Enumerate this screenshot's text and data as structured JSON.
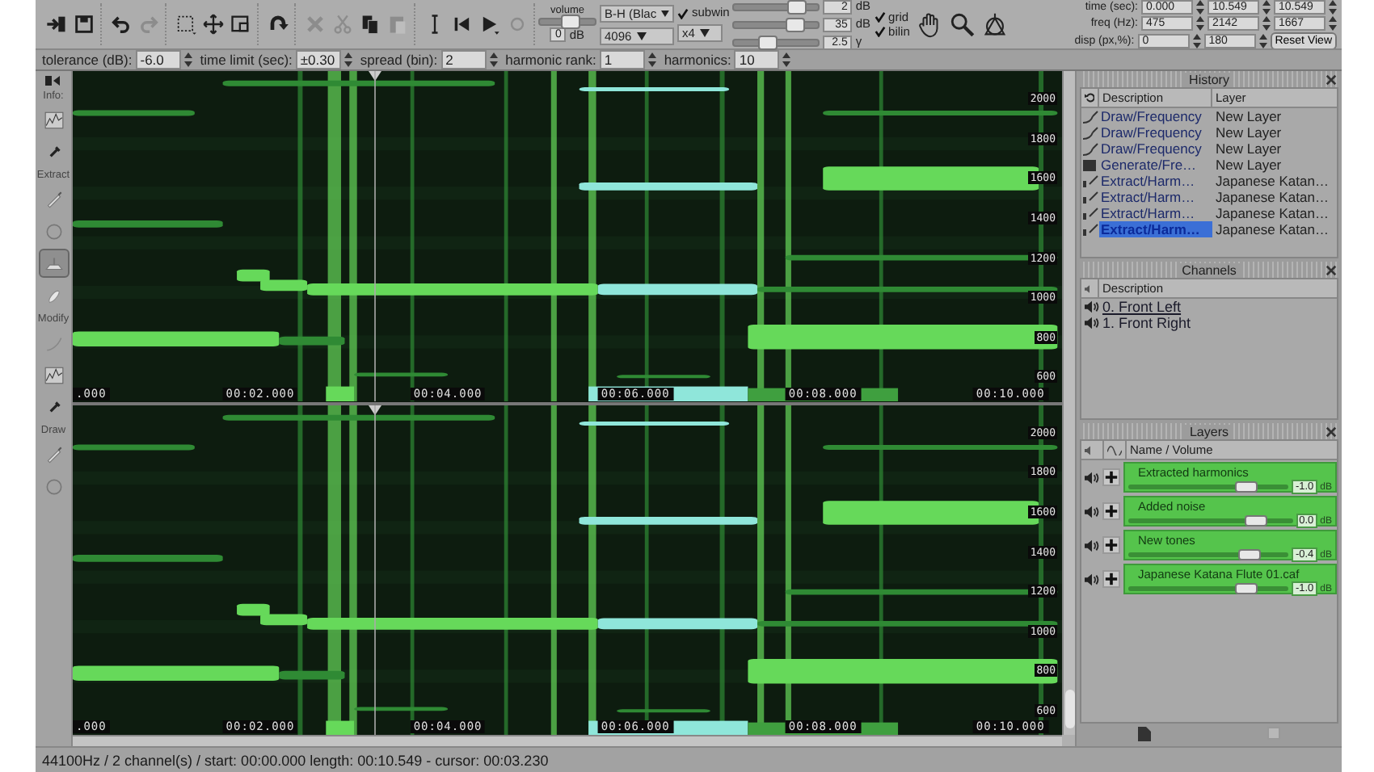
{
  "toolbar": {
    "buttons": [
      {
        "disabled": false
      },
      {
        "disabled": false
      },
      {
        "disabled": false
      },
      {
        "disabled": true
      },
      {
        "disabled": false
      },
      {
        "disabled": false
      },
      {
        "disabled": false
      },
      {
        "disabled": false
      },
      {
        "disabled": true
      },
      {
        "disabled": true
      },
      {
        "disabled": false
      },
      {
        "disabled": true
      },
      {
        "disabled": false
      },
      {
        "disabled": false
      },
      {
        "disabled": false
      },
      {
        "disabled": true
      }
    ],
    "volume": {
      "label": "volume",
      "level": 0.55,
      "value": "0",
      "unit": "dB"
    },
    "display": {
      "window_function": "B-H (Blac",
      "fft_size": "4096",
      "subwin": {
        "label": "subwin",
        "checked": true
      },
      "oversample": "x4",
      "sliders": [
        {
          "level": 0.75,
          "value": "2",
          "unit": "dB"
        },
        {
          "level": 0.72,
          "value": "35",
          "unit": "dB"
        },
        {
          "level": 0.4,
          "value": "2.5",
          "unit": "γ"
        }
      ],
      "checks": [
        {
          "label": "grid",
          "checked": true
        },
        {
          "label": "bilin",
          "checked": true
        }
      ]
    },
    "view": {
      "rows": [
        {
          "label": "time (sec):",
          "values": [
            "0.000",
            "10.549",
            "10.549"
          ]
        },
        {
          "label": "freq (Hz):",
          "values": [
            "475",
            "2142",
            "1667"
          ]
        },
        {
          "label": "disp (px,%):",
          "values": [
            "0",
            "180"
          ]
        }
      ],
      "reset": "Reset View"
    }
  },
  "options": [
    {
      "label": "tolerance (dB):",
      "value": "-6.0"
    },
    {
      "label": "time limit (sec):",
      "value": "±0.30"
    },
    {
      "label": "spread (bin):",
      "value": "2"
    },
    {
      "label": "harmonic rank:",
      "value": "1"
    },
    {
      "label": "harmonics:",
      "value": "10"
    }
  ],
  "tools": [
    {
      "label": "Info:",
      "items": [
        {
          "selected": false
        },
        {
          "selected": false
        }
      ]
    },
    {
      "label": "Extract",
      "items": [
        {
          "selected": false
        },
        {
          "selected": false
        },
        {
          "selected": true
        },
        {
          "selected": false
        }
      ]
    },
    {
      "label": "Modify",
      "items": [
        {
          "selected": false
        },
        {
          "selected": false
        },
        {
          "selected": false
        }
      ]
    },
    {
      "label": "Draw",
      "items": [
        {
          "selected": false
        },
        {
          "selected": false
        }
      ]
    }
  ],
  "channels_view": [
    {
      "time_labels": [
        ".000",
        "00:02.000",
        "00:04.000",
        "00:06.000",
        "00:08.000",
        "00:10.000"
      ],
      "freq_labels": [
        "2000",
        "1800",
        "1600",
        "1400",
        "1200",
        "1000",
        "800",
        "600"
      ]
    },
    {
      "time_labels": [
        ".000",
        "00:02.000",
        "00:04.000",
        "00:06.000",
        "00:08.000",
        "00:10.000"
      ],
      "freq_labels": [
        "2000",
        "1800",
        "1600",
        "1400",
        "1200",
        "1000",
        "800",
        "600"
      ]
    }
  ],
  "history": {
    "title": "History",
    "columns": [
      "Description",
      "Layer"
    ],
    "rows": [
      {
        "kind": "draw",
        "description": "Draw/Frequency",
        "layer": "New Layer",
        "selected": false
      },
      {
        "kind": "draw",
        "description": "Draw/Frequency",
        "layer": "New Layer",
        "selected": false
      },
      {
        "kind": "draw",
        "description": "Draw/Frequency",
        "layer": "New Layer",
        "selected": false
      },
      {
        "kind": "generate",
        "description": "Generate/Fre…",
        "layer": "New Layer",
        "selected": false
      },
      {
        "kind": "extract",
        "description": "Extract/Harm…",
        "layer": "Japanese Katan…",
        "selected": false
      },
      {
        "kind": "extract",
        "description": "Extract/Harm…",
        "layer": "Japanese Katan…",
        "selected": false
      },
      {
        "kind": "extract",
        "description": "Extract/Harm…",
        "layer": "Japanese Katan…",
        "selected": false
      },
      {
        "kind": "extract",
        "description": "Extract/Harm…",
        "layer": "Japanese Katan…",
        "selected": true
      }
    ]
  },
  "channels": {
    "title": "Channels",
    "column": "Description",
    "rows": [
      {
        "name": "0. Front Left",
        "selected": true
      },
      {
        "name": "1. Front Right",
        "selected": false
      }
    ]
  },
  "layers": {
    "title": "Layers",
    "column": "Name / Volume",
    "rows": [
      {
        "name": "Extracted harmonics",
        "level": 0.74,
        "reading": "-1.0",
        "unit": "dB"
      },
      {
        "name": "Added noise",
        "level": 0.78,
        "reading": "0.0",
        "unit": "dB"
      },
      {
        "name": "New tones",
        "level": 0.76,
        "reading": "-0.4",
        "unit": "dB"
      },
      {
        "name": "Japanese Katana Flute 01.caf",
        "level": 0.74,
        "reading": "-1.0",
        "unit": "dB"
      }
    ]
  },
  "status_bar": "44100Hz / 2 channel(s) / start: 00:00.000 length:  00:10.549 - cursor:  00:03.230"
}
